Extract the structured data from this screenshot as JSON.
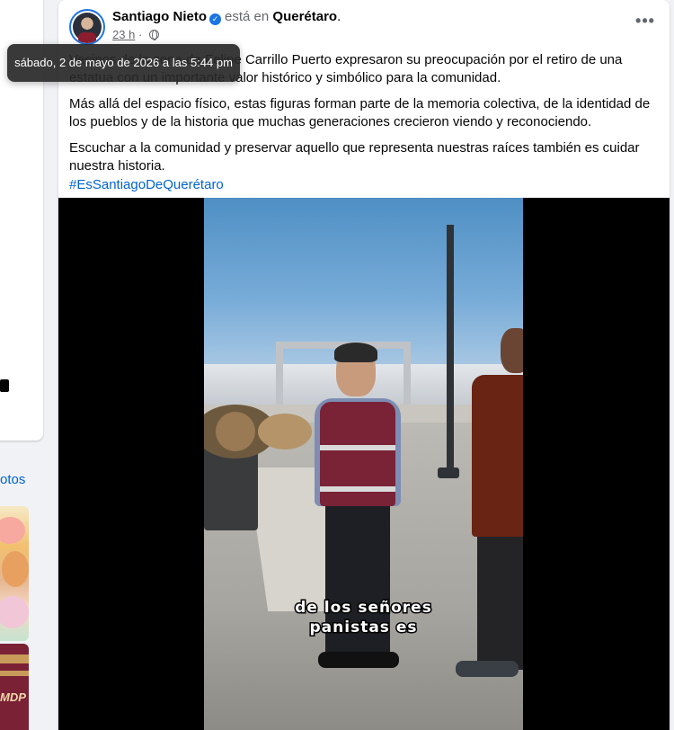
{
  "left_panel": {
    "section_link": "otos",
    "thumb_text": "MDP"
  },
  "post": {
    "author": "Santiago Nieto",
    "at_text": "está en",
    "location": "Querétaro",
    "location_suffix": ".",
    "time": "23 h",
    "separator": "·",
    "privacy_icon": "globe-icon",
    "more_label": "•••",
    "paragraphs": [
      "Vecinos de la zona de Felipe Carrillo Puerto expresaron su preocupación por el retiro de una estatua con un importante valor histórico y simbólico para la comunidad.",
      "Más allá del espacio físico, estas figuras forman parte de la memoria colectiva, de la identidad de los pueblos y de la historia que muchas generaciones crecieron viendo y reconociendo.",
      "Escuchar a la comunidad y preservar aquello que representa nuestras raíces también es cuidar nuestra historia."
    ],
    "hashtag": "#EsSantiagoDeQuerétaro",
    "tooltip": "sábado, 2 de mayo de 2026 a las 5:44 pm",
    "video": {
      "caption_line1": "de los señores",
      "caption_line2": "panistas es"
    }
  },
  "colors": {
    "link": "#0064d1",
    "verified": "#1b74e4",
    "background": "#f0f2f5"
  }
}
